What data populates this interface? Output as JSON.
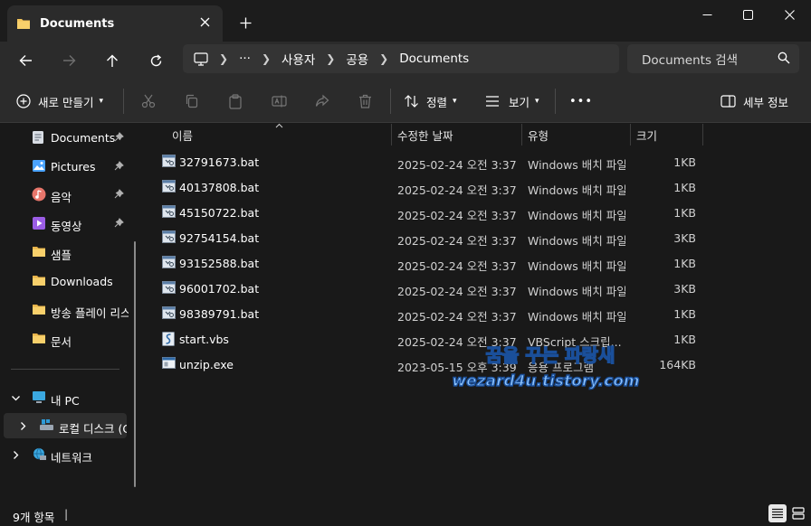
{
  "tab": {
    "title": "Documents",
    "close_icon": "close-icon"
  },
  "window": {
    "minimize": "minimize-icon",
    "maximize": "maximize-icon",
    "close": "close-icon"
  },
  "address": {
    "crumbs": [
      "사용자",
      "공용",
      "Documents"
    ],
    "more": "···"
  },
  "search": {
    "placeholder": "Documents 검색"
  },
  "toolbar": {
    "new_label": "새로 만들기",
    "sort_label": "정렬",
    "view_label": "보기",
    "more_label": "•••",
    "details_label": "세부 정보"
  },
  "sidebar": {
    "quick": [
      {
        "label": "Documents",
        "icon": "documents-icon",
        "pinned": true
      },
      {
        "label": "Pictures",
        "icon": "pictures-icon",
        "pinned": true
      },
      {
        "label": "음악",
        "icon": "music-icon",
        "pinned": true
      },
      {
        "label": "동영상",
        "icon": "video-icon",
        "pinned": true
      },
      {
        "label": "샘플",
        "icon": "folder-icon",
        "pinned": false
      },
      {
        "label": "Downloads",
        "icon": "folder-icon",
        "pinned": false
      },
      {
        "label": "방송 플레이 리스",
        "icon": "folder-icon",
        "pinned": false
      },
      {
        "label": "문서",
        "icon": "folder-icon",
        "pinned": false
      }
    ],
    "this_pc": "내 PC",
    "local_disk": "로컬 디스크 (C",
    "network": "네트워크"
  },
  "columns": {
    "name": "이름",
    "date": "수정한 날짜",
    "type": "유형",
    "size": "크기"
  },
  "files": [
    {
      "name": "32791673.bat",
      "date": "2025-02-24 오전 3:37",
      "type": "Windows 배치 파일",
      "size": "1KB",
      "icon": "bat-file-icon"
    },
    {
      "name": "40137808.bat",
      "date": "2025-02-24 오전 3:37",
      "type": "Windows 배치 파일",
      "size": "1KB",
      "icon": "bat-file-icon"
    },
    {
      "name": "45150722.bat",
      "date": "2025-02-24 오전 3:37",
      "type": "Windows 배치 파일",
      "size": "1KB",
      "icon": "bat-file-icon"
    },
    {
      "name": "92754154.bat",
      "date": "2025-02-24 오전 3:37",
      "type": "Windows 배치 파일",
      "size": "3KB",
      "icon": "bat-file-icon"
    },
    {
      "name": "93152588.bat",
      "date": "2025-02-24 오전 3:37",
      "type": "Windows 배치 파일",
      "size": "1KB",
      "icon": "bat-file-icon"
    },
    {
      "name": "96001702.bat",
      "date": "2025-02-24 오전 3:37",
      "type": "Windows 배치 파일",
      "size": "3KB",
      "icon": "bat-file-icon"
    },
    {
      "name": "98389791.bat",
      "date": "2025-02-24 오전 3:37",
      "type": "Windows 배치 파일",
      "size": "1KB",
      "icon": "bat-file-icon"
    },
    {
      "name": "start.vbs",
      "date": "2025-02-24 오전 3:37",
      "type": "VBScript 스크립...",
      "size": "1KB",
      "icon": "vbs-file-icon"
    },
    {
      "name": "unzip.exe",
      "date": "2023-05-15 오후 3:39",
      "type": "응용 프로그램",
      "size": "164KB",
      "icon": "exe-file-icon"
    }
  ],
  "status": {
    "count": "9개 항목"
  },
  "watermark": {
    "line1": "꿈을 꾸는 파랑새",
    "line2": "wezard4u.tistory.com"
  },
  "colors": {
    "background": "#191919",
    "panel": "#2b2b2b",
    "folder": "#f4c55b",
    "accent": "#4aa3ff"
  }
}
